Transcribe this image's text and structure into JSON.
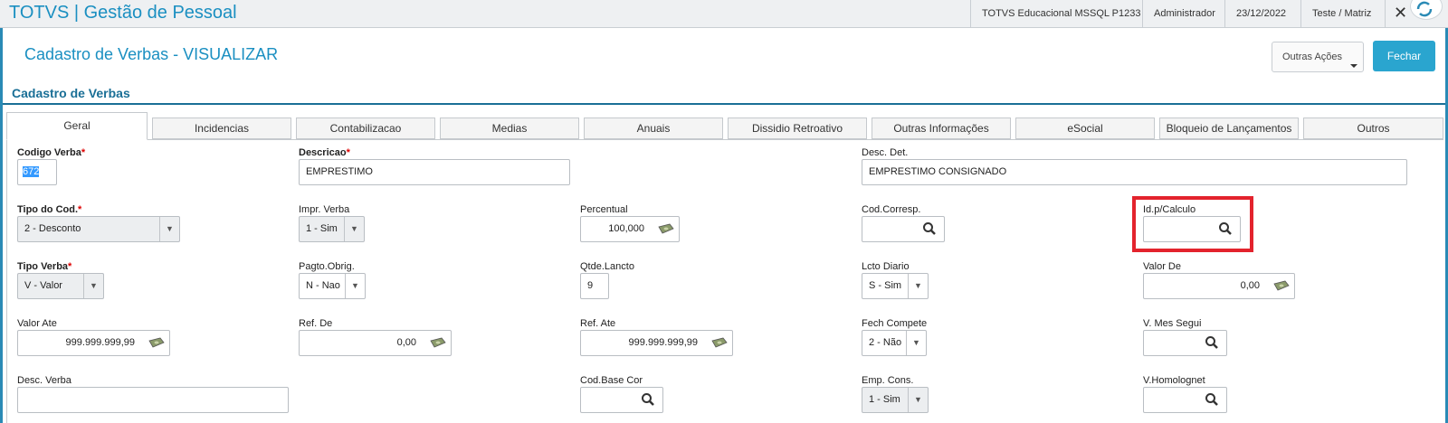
{
  "app": {
    "title": "TOTVS | Gestão de Pessoal",
    "environment": "TOTVS Educacional MSSQL P1233",
    "user": "Administrador",
    "date": "23/12/2022",
    "branch": "Teste / Matriz",
    "close": "✕"
  },
  "header": {
    "page_title": "Cadastro de Verbas - VISUALIZAR",
    "outras_acoes": "Outras Ações",
    "fechar": "Fechar"
  },
  "section_title": "Cadastro de Verbas",
  "tabs": [
    {
      "label": "Geral"
    },
    {
      "label": "Incidencias"
    },
    {
      "label": "Contabilizacao"
    },
    {
      "label": "Medias"
    },
    {
      "label": "Anuais"
    },
    {
      "label": "Dissidio Retroativo"
    },
    {
      "label": "Outras Informações"
    },
    {
      "label": "eSocial"
    },
    {
      "label": "Bloqueio de Lançamentos"
    },
    {
      "label": "Outros"
    }
  ],
  "fields": {
    "codigo_verba": {
      "label": "Codigo Verba",
      "value": "672"
    },
    "descricao": {
      "label": "Descricao",
      "value": "EMPRESTIMO"
    },
    "desc_det": {
      "label": "Desc. Det.",
      "value": "EMPRESTIMO CONSIGNADO"
    },
    "tipo_cod": {
      "label": "Tipo do Cod.",
      "value": "2 - Desconto"
    },
    "impr_verba": {
      "label": "Impr. Verba",
      "value": "1 - Sim"
    },
    "percentual": {
      "label": "Percentual",
      "value": "100,000"
    },
    "cod_corresp": {
      "label": "Cod.Corresp.",
      "value": ""
    },
    "id_calculo": {
      "label": "Id.p/Calculo",
      "value": ""
    },
    "tipo_verba": {
      "label": "Tipo Verba",
      "value": "V - Valor"
    },
    "pagto_obrig": {
      "label": "Pagto.Obrig.",
      "value": "N - Nao"
    },
    "qtde_lancto": {
      "label": "Qtde.Lancto",
      "value": "9"
    },
    "lcto_diario": {
      "label": "Lcto Diario",
      "value": "S - Sim"
    },
    "valor_de": {
      "label": "Valor De",
      "value": "0,00"
    },
    "valor_ate": {
      "label": "Valor Ate",
      "value": "999.999.999,99"
    },
    "ref_de": {
      "label": "Ref. De",
      "value": "0,00"
    },
    "ref_ate": {
      "label": "Ref. Ate",
      "value": "999.999.999,99"
    },
    "fech_compete": {
      "label": "Fech Compete",
      "value": "2 - Não"
    },
    "v_mes_segui": {
      "label": "V. Mes Segui",
      "value": ""
    },
    "desc_verba": {
      "label": "Desc. Verba",
      "value": ""
    },
    "cod_base_cor": {
      "label": "Cod.Base Cor",
      "value": ""
    },
    "emp_cons": {
      "label": "Emp. Cons.",
      "value": "1 - Sim"
    },
    "v_homolognet": {
      "label": "V.Homolognet",
      "value": ""
    }
  },
  "icons": {
    "money": "money-icon",
    "search": "search-icon",
    "dropdown": "chevron-down-icon"
  },
  "colors": {
    "brand": "#1a8fc1",
    "primary_button": "#2aa5cf",
    "highlight": "#e3232d"
  }
}
